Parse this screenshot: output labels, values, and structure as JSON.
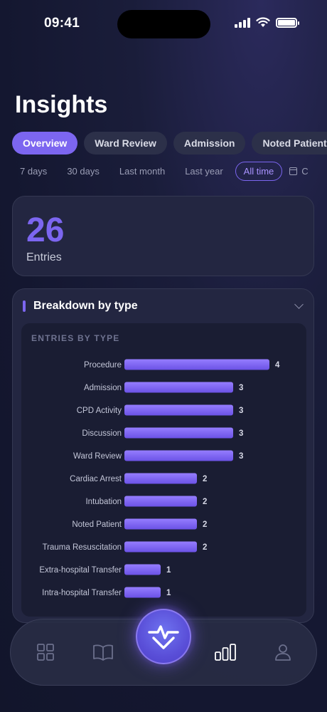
{
  "status_bar": {
    "time": "09:41"
  },
  "page": {
    "title": "Insights"
  },
  "tabs": [
    {
      "label": "Overview",
      "active": true
    },
    {
      "label": "Ward Review",
      "active": false
    },
    {
      "label": "Admission",
      "active": false
    },
    {
      "label": "Noted Patient",
      "active": false
    }
  ],
  "ranges": [
    {
      "label": "7 days",
      "active": false
    },
    {
      "label": "30 days",
      "active": false
    },
    {
      "label": "Last month",
      "active": false
    },
    {
      "label": "Last year",
      "active": false
    },
    {
      "label": "All time",
      "active": true
    },
    {
      "label": "C",
      "active": false,
      "icon": "calendar-icon"
    }
  ],
  "entries": {
    "count": "26",
    "label": "Entries"
  },
  "breakdown": {
    "title": "Breakdown by type",
    "chart_subtitle": "ENTRIES BY TYPE"
  },
  "chart_data": {
    "type": "bar",
    "orientation": "horizontal",
    "title": "ENTRIES BY TYPE",
    "categories": [
      "Procedure",
      "Admission",
      "CPD Activity",
      "Discussion",
      "Ward Review",
      "Cardiac Arrest",
      "Intubation",
      "Noted Patient",
      "Trauma Resuscitation",
      "Extra-hospital Transfer",
      "Intra-hospital Transfer"
    ],
    "values": [
      4,
      3,
      3,
      3,
      3,
      2,
      2,
      2,
      2,
      1,
      1
    ],
    "xlim": [
      0,
      4
    ],
    "grid": false,
    "bar_color": "#7c66f0"
  },
  "nav": {
    "items": [
      "grid-icon",
      "book-icon",
      "add-entry-fab-icon",
      "bar-chart-icon",
      "profile-icon"
    ],
    "active": "bar-chart-icon"
  },
  "colors": {
    "accent": "#7c66f0",
    "card": "#232641",
    "background": "#141730"
  }
}
